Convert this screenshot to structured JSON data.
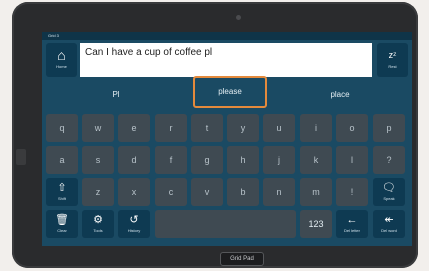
{
  "device": {
    "brand": "Grid Pad"
  },
  "app": {
    "window_title": "Grid 3"
  },
  "toolbar": {
    "home_label": "Home",
    "rest_label": "Rest",
    "clear_label": "Clear",
    "tools_label": "Tools",
    "history_label": "History",
    "shift_label": "Shift",
    "speak_label": "Speak",
    "del_letter_label": "Del letter",
    "del_word_label": "Del word",
    "numbers_label": "123"
  },
  "message": {
    "text": "Can I have a cup of coffee pl"
  },
  "predictions": [
    {
      "label": "Pl"
    },
    {
      "label": "please"
    },
    {
      "label": "place"
    }
  ],
  "keyboard": {
    "row1": [
      "q",
      "w",
      "e",
      "r",
      "t",
      "y",
      "u",
      "i",
      "o",
      "p"
    ],
    "row2": [
      "a",
      "s",
      "d",
      "f",
      "g",
      "h",
      "j",
      "k",
      "l",
      "?"
    ],
    "row3": [
      "z",
      "x",
      "c",
      "v",
      "b",
      "n",
      "m",
      "!"
    ]
  },
  "icons": {
    "home": "home-icon",
    "rest": "zzz-icon",
    "clear": "trash-icon",
    "tools": "gear-icon",
    "history": "history-icon",
    "shift": "shift-arrow-icon",
    "speak": "speech-bubble-icon",
    "del_letter": "backspace-arrow-icon",
    "del_word": "double-backspace-icon"
  },
  "colors": {
    "screen_bg": "#1a4a63",
    "key_bg": "#3f4a52",
    "highlight": "#e48a3c"
  }
}
